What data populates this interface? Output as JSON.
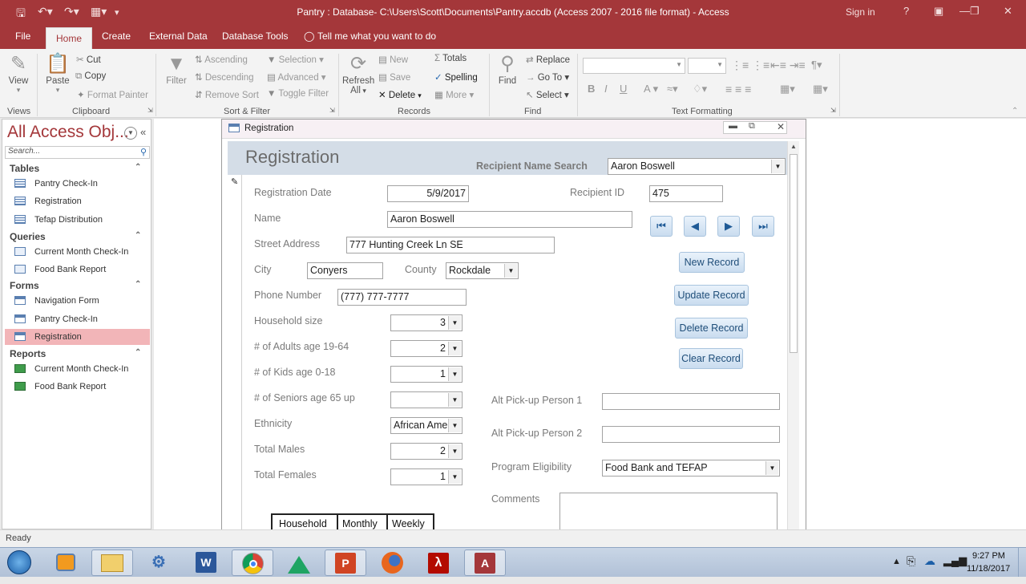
{
  "titlebar": {
    "title": "Pantry : Database- C:\\Users\\Scott\\Documents\\Pantry.accdb (Access 2007 - 2016 file format)  -  Access",
    "signin": "Sign in",
    "help": "?"
  },
  "ribbon_tabs": [
    "File",
    "Home",
    "Create",
    "External Data",
    "Database Tools"
  ],
  "tell_me": "Tell me what you want to do",
  "ribbon": {
    "view": "View",
    "paste": "Paste",
    "cut": "Cut",
    "copy": "Copy",
    "format_painter": "Format Painter",
    "filter": "Filter",
    "ascending": "Ascending",
    "descending": "Descending",
    "remove_sort": "Remove Sort",
    "selection": "Selection",
    "advanced": "Advanced",
    "toggle_filter": "Toggle Filter",
    "refresh": "Refresh",
    "refresh_all": "All",
    "new": "New",
    "save": "Save",
    "delete": "Delete",
    "totals": "Totals",
    "spelling": "Spelling",
    "more": "More",
    "find": "Find",
    "replace": "Replace",
    "goto": "Go To",
    "select": "Select",
    "bold": "B",
    "italic": "I",
    "underline": "U",
    "font_color": "A",
    "groups": {
      "views": "Views",
      "clipboard": "Clipboard",
      "sort_filter": "Sort & Filter",
      "records": "Records",
      "find": "Find",
      "text_formatting": "Text Formatting"
    }
  },
  "nav": {
    "header": "All Access Obj...",
    "search_placeholder": "Search...",
    "categories": [
      {
        "name": "Tables",
        "items": [
          "Pantry Check-In",
          "Registration",
          "Tefap Distribution"
        ]
      },
      {
        "name": "Queries",
        "items": [
          "Current Month Check-In",
          "Food Bank Report"
        ]
      },
      {
        "name": "Forms",
        "items": [
          "Navigation Form",
          "Pantry Check-In",
          "Registration"
        ]
      },
      {
        "name": "Reports",
        "items": [
          "Current Month Check-In",
          "Food Bank Report"
        ]
      }
    ],
    "selected": "Forms/Registration"
  },
  "form": {
    "window_title": "Registration",
    "header_title": "Registration",
    "recipient_search_label": "Recipient Name Search",
    "recipient_search_value": "Aaron Boswell",
    "fields": {
      "registration_date_label": "Registration Date",
      "registration_date": "5/9/2017",
      "recipient_id_label": "Recipient ID",
      "recipient_id": "475",
      "name_label": "Name",
      "name": "Aaron Boswell",
      "street_label": "Street Address",
      "street": "777 Hunting Creek Ln SE",
      "city_label": "City",
      "city": "Conyers",
      "county_label": "County",
      "county": "Rockdale",
      "phone_label": "Phone Number",
      "phone": "(777) 777-7777",
      "household_size_label": "Household size",
      "household_size": "3",
      "adults_label": "# of Adults age 19-64",
      "adults": "2",
      "kids_label": "# of Kids age 0-18",
      "kids": "1",
      "seniors_label": "# of Seniors age 65 up",
      "seniors": "",
      "ethnicity_label": "Ethnicity",
      "ethnicity": "African Ame",
      "males_label": "Total Males",
      "males": "2",
      "females_label": "Total Females",
      "females": "1",
      "alt1_label": "Alt Pick-up Person 1",
      "alt1": "",
      "alt2_label": "Alt Pick-up Person 2",
      "alt2": "",
      "eligibility_label": "Program Eligibility",
      "eligibility": "Food Bank and TEFAP",
      "comments_label": "Comments",
      "comments": ""
    },
    "buttons": {
      "new_record": "New Record",
      "update_record": "Update Record",
      "delete_record": "Delete Record",
      "clear_record": "Clear Record"
    },
    "table_headers": [
      "Household",
      "Monthly",
      "Weekly"
    ]
  },
  "status": "Ready",
  "clock": {
    "time": "9:27 PM",
    "date": "11/18/2017"
  },
  "taskbar_apps": [
    "start-orb",
    "media-player",
    "file-explorer",
    "sharing-app",
    "word",
    "chrome",
    "google-drive",
    "powerpoint",
    "firefox",
    "acrobat",
    "access"
  ]
}
